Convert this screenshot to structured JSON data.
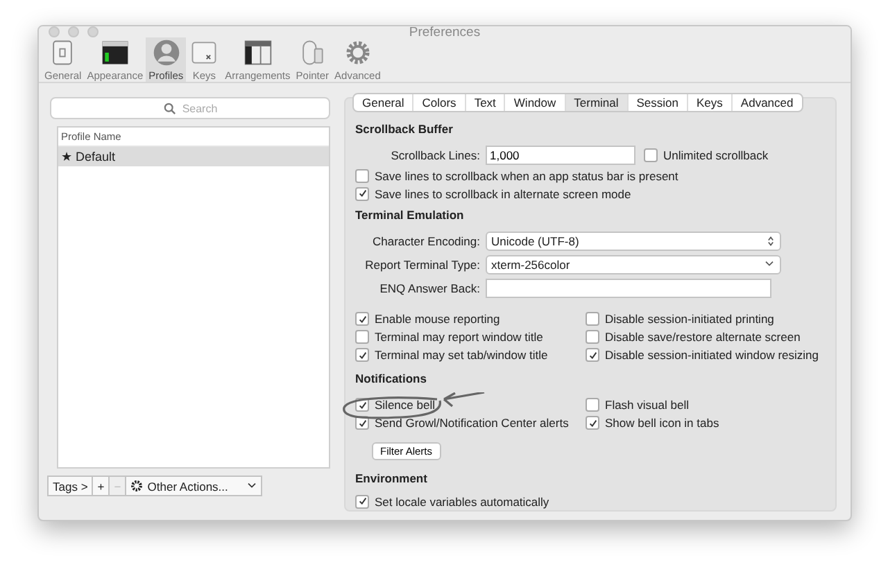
{
  "window": {
    "title": "Preferences"
  },
  "toolbar": [
    {
      "label": "General",
      "selected": false
    },
    {
      "label": "Appearance",
      "selected": false
    },
    {
      "label": "Profiles",
      "selected": true
    },
    {
      "label": "Keys",
      "selected": false
    },
    {
      "label": "Arrangements",
      "selected": false
    },
    {
      "label": "Pointer",
      "selected": false
    },
    {
      "label": "Advanced",
      "selected": false
    }
  ],
  "search": {
    "placeholder": "Search"
  },
  "profiles": {
    "column": "Profile Name",
    "rows": [
      {
        "name": "★ Default",
        "selected": true
      }
    ]
  },
  "profile_buttons": {
    "tags": "Tags >",
    "add": "+",
    "remove": "−",
    "remove_disabled": true,
    "actions": "Other Actions..."
  },
  "tabs": [
    {
      "label": "General",
      "selected": false
    },
    {
      "label": "Colors",
      "selected": false
    },
    {
      "label": "Text",
      "selected": false
    },
    {
      "label": "Window",
      "selected": false
    },
    {
      "label": "Terminal",
      "selected": true
    },
    {
      "label": "Session",
      "selected": false
    },
    {
      "label": "Keys",
      "selected": false
    },
    {
      "label": "Advanced",
      "selected": false
    }
  ],
  "sections": [
    {
      "heading": "Scrollback Buffer",
      "rows": [
        {
          "kind": "field",
          "label": "Scrollback Lines:",
          "value": "1,000",
          "extra": {
            "label": "Unlimited scrollback",
            "checked": false
          }
        },
        {
          "kind": "check",
          "label": "Save lines to scrollback when an app status bar is present",
          "checked": false
        },
        {
          "kind": "check",
          "label": "Save lines to scrollback in alternate screen mode",
          "checked": true
        }
      ]
    },
    {
      "heading": "Terminal Emulation",
      "rows": [
        {
          "kind": "popup",
          "label": "Character Encoding:",
          "value": "Unicode (UTF-8)"
        },
        {
          "kind": "combo",
          "label": "Report Terminal Type:",
          "value": "xterm-256color"
        },
        {
          "kind": "field",
          "label": "ENQ Answer Back:",
          "value": ""
        },
        {
          "kind": "grid",
          "items": [
            {
              "label": "Enable mouse reporting",
              "checked": true
            },
            {
              "label": "Disable session-initiated printing",
              "checked": false
            },
            {
              "label": "Terminal may report window title",
              "checked": false
            },
            {
              "label": "Disable save/restore alternate screen",
              "checked": false
            },
            {
              "label": "Terminal may set tab/window title",
              "checked": true
            },
            {
              "label": "Disable session-initiated window resizing",
              "checked": true
            }
          ]
        }
      ]
    },
    {
      "heading": "Notifications",
      "rows": [
        {
          "kind": "grid",
          "items": [
            {
              "label": "Silence bell",
              "checked": true
            },
            {
              "label": "Flash visual bell",
              "checked": false
            },
            {
              "label": "Send Growl/Notification Center alerts",
              "checked": true
            },
            {
              "label": "Show bell icon in tabs",
              "checked": true
            }
          ]
        },
        {
          "kind": "button",
          "label": "Filter Alerts"
        }
      ]
    },
    {
      "heading": "Environment",
      "rows": [
        {
          "kind": "check",
          "label": "Set locale variables automatically",
          "checked": true
        }
      ]
    }
  ]
}
